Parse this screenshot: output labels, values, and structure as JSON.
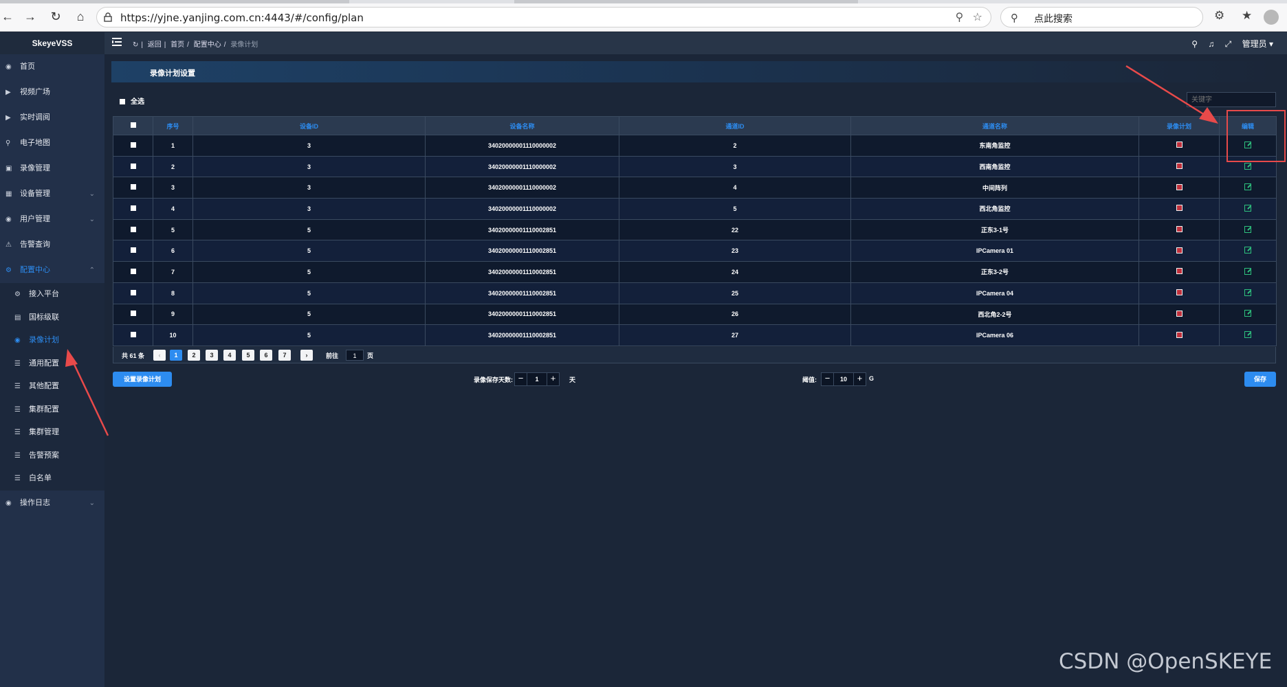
{
  "browser": {
    "url": "https://yjne.yanjing.com.cn:4443/#/config/plan",
    "search_placeholder": "点此搜索"
  },
  "app": {
    "logo": "SkeyeVSS",
    "breadcrumb": [
      "返回",
      "首页",
      "配置中心",
      "录像计划"
    ],
    "user": "管理员"
  },
  "sidebar": {
    "items": [
      {
        "label": "首页",
        "icon": "dashboard-icon"
      },
      {
        "label": "视频广场",
        "icon": "video-icon"
      },
      {
        "label": "实时调阅",
        "icon": "live-icon"
      },
      {
        "label": "电子地图",
        "icon": "map-icon"
      },
      {
        "label": "录像管理",
        "icon": "record-icon"
      },
      {
        "label": "设备管理",
        "icon": "device-icon"
      },
      {
        "label": "用户管理",
        "icon": "user-icon"
      },
      {
        "label": "告警查询",
        "icon": "alarm-icon"
      },
      {
        "label": "配置中心",
        "icon": "gear-icon"
      }
    ],
    "config_sub": [
      {
        "label": "接入平台"
      },
      {
        "label": "国标级联"
      },
      {
        "label": "录像计划"
      },
      {
        "label": "通用配置"
      },
      {
        "label": "其他配置"
      },
      {
        "label": "集群配置"
      },
      {
        "label": "集群管理"
      },
      {
        "label": "告警预案"
      },
      {
        "label": "白名单"
      }
    ],
    "log": {
      "label": "操作日志"
    }
  },
  "main": {
    "title": "录像计划设置",
    "select_all": "全选",
    "keyword_placeholder": "关键字",
    "columns": [
      "序号",
      "设备ID",
      "设备名称",
      "通道ID",
      "通道名称",
      "录像计划",
      "编辑"
    ],
    "rows": [
      {
        "no": "1",
        "device_id": "3",
        "device_name": "34020000001110000002",
        "channel_id": "2",
        "channel_name": "东南角监控"
      },
      {
        "no": "2",
        "device_id": "3",
        "device_name": "34020000001110000002",
        "channel_id": "3",
        "channel_name": "西南角监控"
      },
      {
        "no": "3",
        "device_id": "3",
        "device_name": "34020000001110000002",
        "channel_id": "4",
        "channel_name": "中间阵列"
      },
      {
        "no": "4",
        "device_id": "3",
        "device_name": "34020000001110000002",
        "channel_id": "5",
        "channel_name": "西北角监控"
      },
      {
        "no": "5",
        "device_id": "5",
        "device_name": "34020000001110002851",
        "channel_id": "22",
        "channel_name": "正东3-1号"
      },
      {
        "no": "6",
        "device_id": "5",
        "device_name": "34020000001110002851",
        "channel_id": "23",
        "channel_name": "IPCamera 01"
      },
      {
        "no": "7",
        "device_id": "5",
        "device_name": "34020000001110002851",
        "channel_id": "24",
        "channel_name": "正东3-2号"
      },
      {
        "no": "8",
        "device_id": "5",
        "device_name": "34020000001110002851",
        "channel_id": "25",
        "channel_name": "IPCamera 04"
      },
      {
        "no": "9",
        "device_id": "5",
        "device_name": "34020000001110002851",
        "channel_id": "26",
        "channel_name": "西北角2-2号"
      },
      {
        "no": "10",
        "device_id": "5",
        "device_name": "34020000001110002851",
        "channel_id": "27",
        "channel_name": "IPCamera 06"
      }
    ],
    "pager": {
      "total": "共 61 条",
      "pages": [
        "1",
        "2",
        "3",
        "4",
        "5",
        "6",
        "7"
      ],
      "current": "1",
      "goto_label": "前往",
      "goto_value": "1",
      "goto_suffix": "页"
    },
    "bottom": {
      "set_plan_button": "设置录像计划",
      "days_label": "录像保存天数:",
      "days_value": "1",
      "days_unit": "天",
      "threshold_label": "阈值:",
      "threshold_value": "10",
      "threshold_unit": "G",
      "save_button": "保存"
    }
  },
  "watermark": "CSDN @OpenSKEYE",
  "colors": {
    "accent": "#2d8cf0",
    "record": "#c0303c",
    "edit": "#2ec27e",
    "annotation": "#e84a4a"
  }
}
